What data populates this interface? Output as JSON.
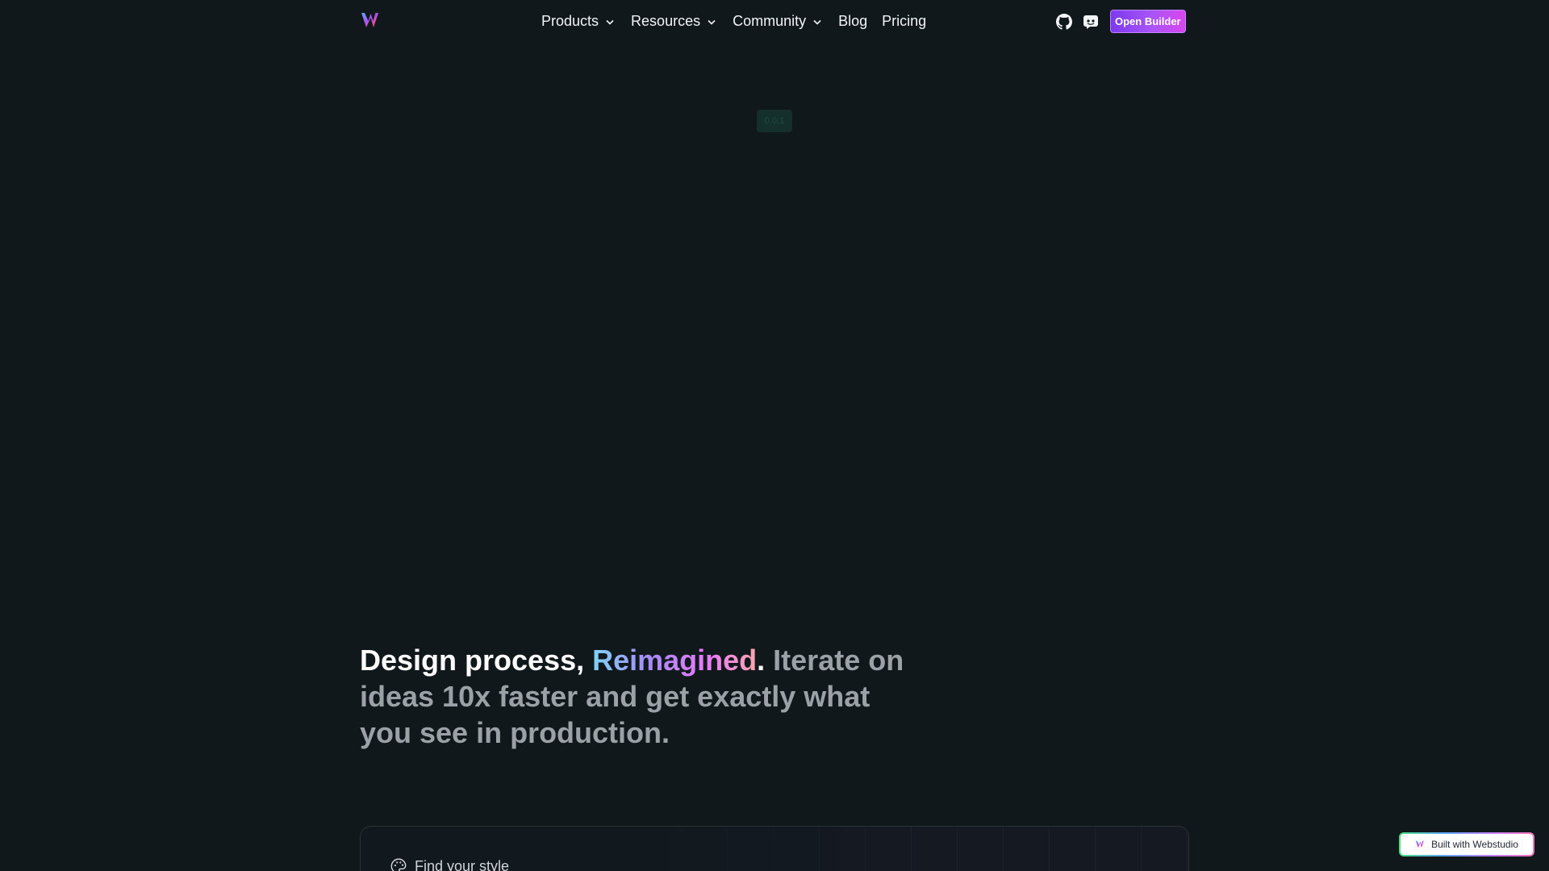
{
  "header": {
    "nav": [
      {
        "label": "Products"
      },
      {
        "label": "Resources"
      },
      {
        "label": "Community"
      },
      {
        "label": "Blog"
      },
      {
        "label": "Pricing"
      }
    ],
    "icons": [
      "webstudio-logo-icon",
      "github-icon",
      "discord-icon",
      "chevron-down-icon"
    ],
    "open_builder_label": "Open Builder"
  },
  "badge": {
    "label": "0.0.1"
  },
  "hero": {
    "part1": "Design process, ",
    "highlight": "Reimagined",
    "period": ".",
    "rest": " Iterate on ideas 10x faster and get exactly what you see in production."
  },
  "card": {
    "find_style_label": "Find your style",
    "icon": "palette-icon"
  },
  "footer_badge": {
    "label": "Built with Webstudio"
  },
  "colors": {
    "background": "#11181c",
    "accent_start": "#7c3aed",
    "accent_end": "#d946ef",
    "muted_text": "#9ba1a6"
  }
}
